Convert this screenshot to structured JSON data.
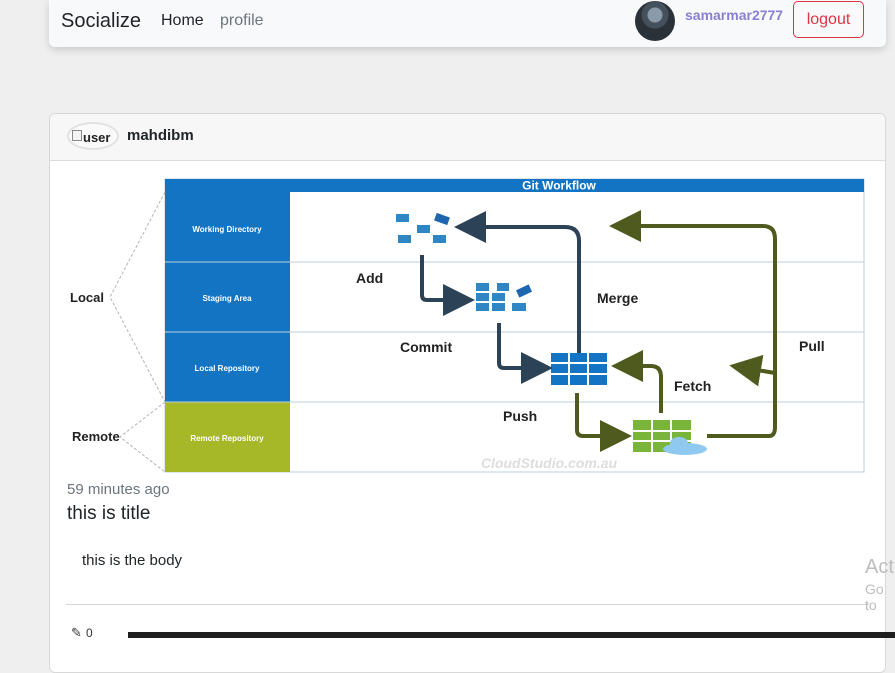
{
  "navbar": {
    "brand": "Socialize",
    "links": [
      "Home",
      "profile"
    ],
    "username": "samarmar2777",
    "logout_label": "logout"
  },
  "post": {
    "author": "mahdibm",
    "avatar_alt": "user",
    "image": {
      "title": "Git Workflow",
      "rows": [
        "Working Directory",
        "Staging Area",
        "Local Repository",
        "Remote Repository"
      ],
      "groups": [
        "Local",
        "Remote"
      ],
      "actions": [
        "Add",
        "Commit",
        "Push",
        "Merge",
        "Fetch",
        "Pull"
      ],
      "credit": "CloudStudio.com.au"
    },
    "time_ago": "59 minutes ago",
    "title": "this is title",
    "body": "this is the body",
    "like_count": "0"
  },
  "watermark": {
    "line1": "Act",
    "line2": "Go to"
  }
}
